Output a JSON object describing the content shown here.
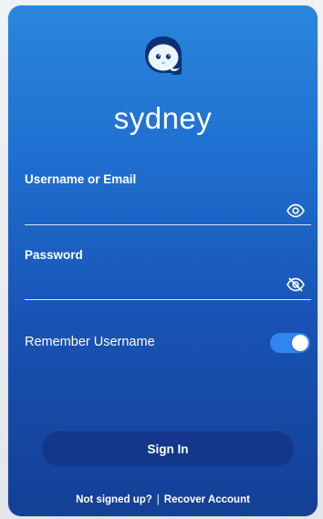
{
  "app": {
    "brand_name": "sydney",
    "logo_icon": "sydney-mascot-icon"
  },
  "colors": {
    "gradient_top": "#2a86dc",
    "gradient_bottom": "#143f95",
    "button_bg": "#13378a",
    "toggle_on": "#2f86ee",
    "text": "#ffffff"
  },
  "form": {
    "username": {
      "label": "Username or Email",
      "value": "",
      "placeholder": "",
      "toggle_icon": "eye-icon"
    },
    "password": {
      "label": "Password",
      "value": "",
      "placeholder": "",
      "toggle_icon": "eye-off-icon"
    },
    "remember": {
      "label": "Remember Username",
      "enabled": true
    },
    "sign_in_label": "Sign In"
  },
  "footer": {
    "signup_link": "Not signed up?",
    "separator": "|",
    "recover_link": "Recover Account"
  }
}
